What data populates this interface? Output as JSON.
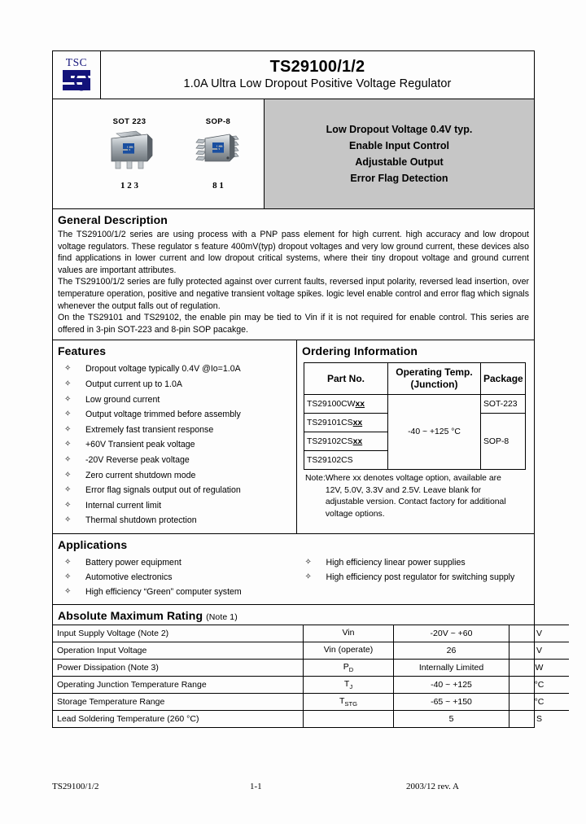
{
  "header": {
    "logo_text": "TSC",
    "title": "TS29100/1/2",
    "subtitle": "1.0A Ultra Low Dropout Positive Voltage Regulator"
  },
  "packages": [
    {
      "label": "SOT 223",
      "pins": "1  2  3"
    },
    {
      "label": "SOP-8",
      "pins": "8            1"
    }
  ],
  "highlights": [
    "Low Dropout Voltage 0.4V typ.",
    "Enable Input Control",
    "Adjustable Output",
    "Error Flag Detection"
  ],
  "general_description": {
    "heading": "General Description",
    "paragraphs": [
      "The TS29100/1/2 series are using process with a PNP pass element for high current. high accuracy and low dropout voltage regulators. These regulator s feature 400mV(typ) dropout voltages and very low ground current, these devices also find applications in lower current and low dropout critical systems, where their tiny dropout voltage and ground current values are important attributes.",
      "The TS29100/1/2 series are fully protected against over current faults, reversed input polarity, reversed lead insertion, over temperature operation, positive and negative transient voltage spikes. logic level enable control and error flag which signals whenever the output falls out of regulation.",
      "On the TS29101 and TS29102, the enable pin may be tied to Vin if it is not required for enable control. This series are offered in 3-pin SOT-223 and 8-pin SOP pacakge."
    ]
  },
  "features": {
    "heading": "Features",
    "items": [
      "Dropout voltage typically 0.4V @Io=1.0A",
      "Output current up to 1.0A",
      "Low ground current",
      "Output voltage trimmed before assembly",
      "Extremely fast transient response",
      "+60V Transient peak voltage",
      "-20V Reverse peak voltage",
      "Zero current shutdown mode",
      "Error flag signals output out of regulation",
      "Internal current limit",
      "Thermal shutdown protection"
    ]
  },
  "ordering": {
    "heading": "Ordering Information",
    "columns": {
      "part": "Part No.",
      "temp_line1": "Operating Temp.",
      "temp_line2": "(Junction)",
      "package": "Package"
    },
    "parts": [
      {
        "prefix": "TS29100CW",
        "suffix": "xx"
      },
      {
        "prefix": "TS29101CS",
        "suffix": "xx"
      },
      {
        "prefix": "TS29102CS",
        "suffix": "xx"
      },
      {
        "prefix": "TS29102CS",
        "suffix": ""
      }
    ],
    "temperature": "-40 ~ +125 °C",
    "package_sot": "SOT-223",
    "package_sop": "SOP-8",
    "note_label": "Note:",
    "note_lines": [
      "Where xx denotes voltage option, available are",
      "12V, 5.0V, 3.3V and 2.5V. Leave blank for",
      "adjustable version. Contact factory for additional",
      "voltage options."
    ]
  },
  "applications": {
    "heading": "Applications",
    "left": [
      "Battery power equipment",
      "Automotive electronics",
      "High efficiency “Green” computer system"
    ],
    "right": [
      "High efficiency linear power supplies",
      "High efficiency post regulator for switching supply"
    ]
  },
  "absolute_maximum_rating": {
    "heading": "Absolute Maximum Rating",
    "heading_note": "(Note 1)",
    "rows": [
      {
        "parameter": "Input Supply Voltage (Note 2)",
        "symbol": "Vin",
        "symbol_sub": "",
        "value": "-20V ~ +60",
        "unit": "V"
      },
      {
        "parameter": "Operation Input Voltage",
        "symbol": "Vin (operate)",
        "symbol_sub": "",
        "value": "26",
        "unit": "V"
      },
      {
        "parameter": "Power Dissipation (Note 3)",
        "symbol": "P",
        "symbol_sub": "D",
        "value": "Internally Limited",
        "unit": "W"
      },
      {
        "parameter": "Operating Junction Temperature Range",
        "symbol": "T",
        "symbol_sub": "J",
        "value": "-40 ~ +125",
        "unit": "°C"
      },
      {
        "parameter": "Storage Temperature Range",
        "symbol": "T",
        "symbol_sub": "STG",
        "value": "-65 ~ +150",
        "unit": "°C"
      },
      {
        "parameter": "Lead Soldering Temperature (260 °C)",
        "symbol": "",
        "symbol_sub": "",
        "value": "5",
        "unit": "S"
      }
    ]
  },
  "footer": {
    "left": "TS29100/1/2",
    "center": "1-1",
    "right": "2003/12 rev. A"
  },
  "colors": {
    "logo_blue": "#12127a",
    "highlight_band": "#c6c6c6"
  }
}
